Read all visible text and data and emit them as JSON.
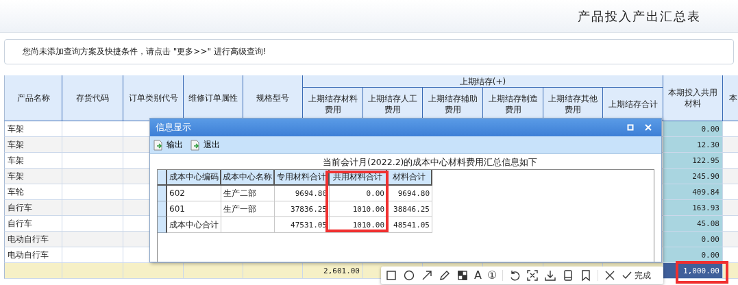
{
  "page": {
    "title": "产品投入产出汇总表"
  },
  "hint": "您尚未添加查询方案及快捷条件，请点击 \"更多>>\" 进行高级查询!",
  "grid": {
    "group_label": "上期结存(+)",
    "columns": [
      {
        "label": "产品名称",
        "grouped": false
      },
      {
        "label": "存货代码",
        "grouped": false
      },
      {
        "label": "订单类别代号",
        "grouped": false
      },
      {
        "label": "维修订单属性",
        "grouped": false
      },
      {
        "label": "规格型号",
        "grouped": false
      },
      {
        "label": "上期结存材料费用",
        "grouped": true
      },
      {
        "label": "上期结存人工费用",
        "grouped": true
      },
      {
        "label": "上期结存辅助费用",
        "grouped": true
      },
      {
        "label": "上期结存制造费用",
        "grouped": true
      },
      {
        "label": "上期结存其他费用",
        "grouped": true
      },
      {
        "label": "上期结存合计",
        "grouped": true
      },
      {
        "label": "本期投入共用材料",
        "grouped": false
      },
      {
        "label": "本",
        "grouped": false
      }
    ],
    "rows": [
      {
        "product": "车架",
        "shared_material": "0.00"
      },
      {
        "product": "车架",
        "shared_material": "12.30"
      },
      {
        "product": "车架",
        "shared_material": "122.95"
      },
      {
        "product": "车架",
        "shared_material": "245.90"
      },
      {
        "product": "车轮",
        "shared_material": "409.84"
      },
      {
        "product": "自行车",
        "shared_material": "163.93"
      },
      {
        "product": "自行车",
        "shared_material": "45.08"
      },
      {
        "product": "电动自行车",
        "shared_material": "0.00"
      },
      {
        "product": "电动自行车",
        "shared_material": "0.00"
      }
    ],
    "total_row": {
      "prior_material": {
        "text": "2,601.00",
        "selected": false
      },
      "shared_material": {
        "text": "1,000.00",
        "selected": true
      }
    }
  },
  "dialog": {
    "title": "信息显示",
    "toolbar": [
      "输出",
      "退出"
    ],
    "caption": "当前会计月(2022.2)的成本中心材料费用汇总信息如下",
    "table": {
      "columns": [
        "成本中心编码",
        "成本中心名称",
        "专用材料合计",
        "共用材料合计",
        "材料合计"
      ],
      "rows": [
        [
          "602",
          "生产二部",
          "9694.80",
          "0.00",
          "9694.80"
        ],
        [
          "601",
          "生产一部",
          "37836.25",
          "1010.00",
          "38846.25"
        ],
        [
          "成本中心合计",
          null,
          "47531.05",
          "1010.00",
          "48541.05"
        ]
      ]
    }
  },
  "capture_toolbar": {
    "text_tool": "A",
    "number_tool": "①",
    "done": "完成"
  }
}
